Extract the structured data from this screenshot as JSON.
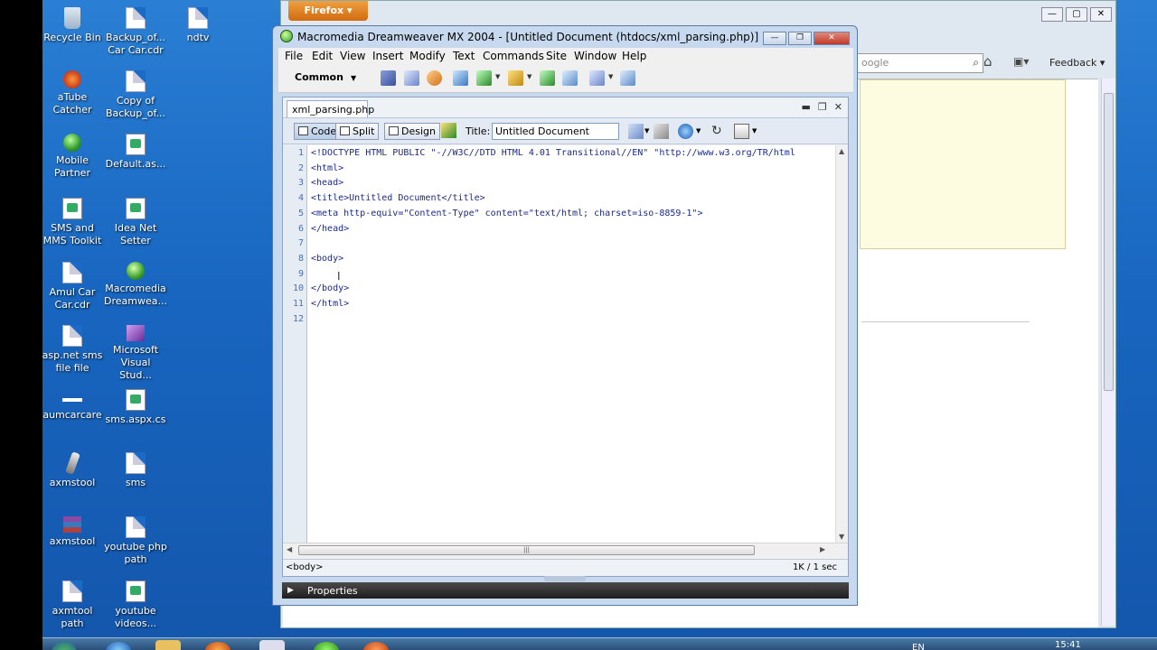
{
  "desktop": {
    "icons": [
      {
        "label": "Recycle Bin"
      },
      {
        "label": "Backup_of...\nCar Car.cdr"
      },
      {
        "label": "ndtv"
      },
      {
        "label": "aTube\nCatcher"
      },
      {
        "label": "Copy of\nBackup_of..."
      },
      {
        "label": "Mobile\nPartner"
      },
      {
        "label": "Default.as..."
      },
      {
        "label": "SMS and\nMMS Toolkit"
      },
      {
        "label": "Idea Net\nSetter"
      },
      {
        "label": "Amul Car\nCar.cdr"
      },
      {
        "label": "Macromedia\nDreamwea..."
      },
      {
        "label": "asp.net sms\nfile file"
      },
      {
        "label": "Microsoft\nVisual Stud..."
      },
      {
        "label": "aumcarcare"
      },
      {
        "label": "sms.aspx.cs"
      },
      {
        "label": "axmstool"
      },
      {
        "label": "sms"
      },
      {
        "label": "axmstool"
      },
      {
        "label": "youtube php\npath"
      },
      {
        "label": "axmtool path"
      },
      {
        "label": "youtube\nvideos..."
      }
    ]
  },
  "taskbar": {
    "language": "EN",
    "clock": "15:41"
  },
  "firefox": {
    "app_button": "Firefox ▾",
    "search_placeholder": "oogle",
    "feedback_label": "Feedback"
  },
  "dreamweaver": {
    "window_title": "Macromedia Dreamweaver MX 2004 - [Untitled Document (htdocs/xml_parsing.php)]",
    "menu": [
      "File",
      "Edit",
      "View",
      "Insert",
      "Modify",
      "Text",
      "Commands",
      "Site",
      "Window",
      "Help"
    ],
    "insert_category": "Common",
    "document_tab": "xml_parsing.php",
    "view_buttons": {
      "code": "Code",
      "split": "Split",
      "design": "Design"
    },
    "title_label": "Title:",
    "title_value": "Untitled Document",
    "code_lines": [
      "<!DOCTYPE HTML PUBLIC \"-//W3C//DTD HTML 4.01 Transitional//EN\" \"http://www.w3.org/TR/html",
      "<html>",
      "<head>",
      "<title>Untitled Document</title>",
      "<meta http-equiv=\"Content-Type\" content=\"text/html; charset=iso-8859-1\">",
      "</head>",
      "",
      "<body>",
      "",
      "</body>",
      "</html>",
      ""
    ],
    "line_numbers": [
      "1",
      "2",
      "3",
      "4",
      "5",
      "6",
      "7",
      "8",
      "9",
      "10",
      "11",
      "12"
    ],
    "status_tag": "<body>",
    "status_size_time": "1K / 1 sec",
    "properties_label": "Properties"
  }
}
